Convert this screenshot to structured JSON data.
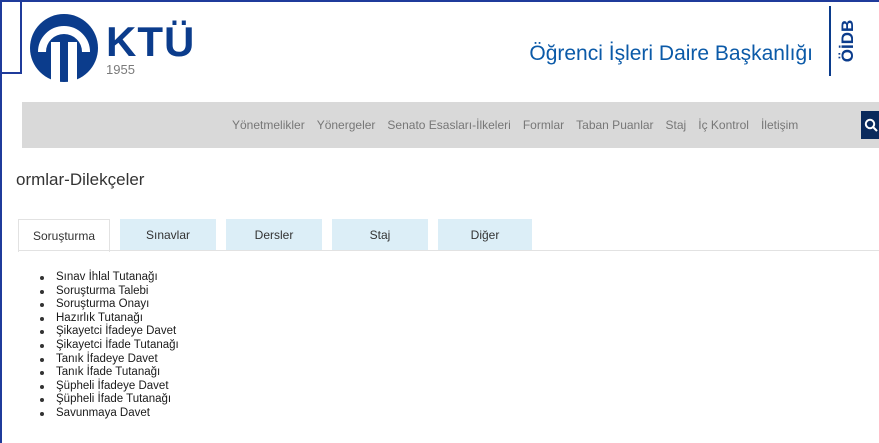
{
  "header": {
    "logo_text": "KTÜ",
    "logo_year": "1955",
    "unit_title": "Öğrenci İşleri Daire Başkanlığı",
    "unit_abbr": "ÖİDB"
  },
  "nav": {
    "items": [
      "Yönetmelikler",
      "Yönergeler",
      "Senato Esasları-İlkeleri",
      "Formlar",
      "Taban Puanlar",
      "Staj",
      "İç Kontrol",
      "İletişim"
    ]
  },
  "page_title": "ormlar-Dilekçeler",
  "tabs": [
    "Soruşturma",
    "Sınavlar",
    "Dersler",
    "Staj",
    "Diğer"
  ],
  "active_tab": "Soruşturma",
  "list_items": [
    "Sınav İhlal Tutanağı",
    "Soruşturma Talebi",
    "Soruşturma Onayı",
    "Hazırlık Tutanağı",
    "Şikayetci İfadeye Davet",
    "Şikayetci İfade Tutanağı",
    "Tanık İfadeye Davet",
    "Tanık İfade Tutanağı",
    "Şüpheli İfadeye Davet",
    "Şüpheli İfade Tutanağı",
    "Savunmaya Davet"
  ],
  "colors": {
    "brand": "#0b3c8c",
    "nav_bg": "#d9d9d9",
    "tab_bg": "#dceef7",
    "search_bg": "#0a2a5c"
  },
  "icons": [
    "ktu-logo-icon",
    "search-icon"
  ]
}
